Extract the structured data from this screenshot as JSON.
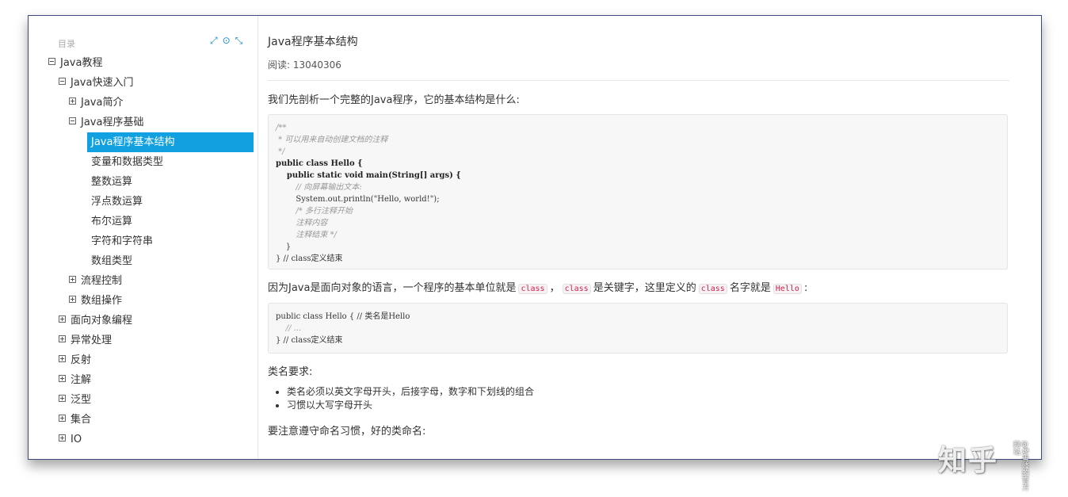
{
  "sidebar": {
    "toc_label": "目录",
    "tools": {
      "expand_icon": "⤢",
      "locate_icon": "⊙",
      "collapse_icon": "⤡"
    },
    "items": [
      {
        "label": "Java教程",
        "level": 0,
        "toggle": "minus"
      },
      {
        "label": "Java快速入门",
        "level": 1,
        "toggle": "minus"
      },
      {
        "label": "Java简介",
        "level": 2,
        "toggle": "plus"
      },
      {
        "label": "Java程序基础",
        "level": 2,
        "toggle": "minus"
      },
      {
        "label": "Java程序基本结构",
        "level": 3,
        "toggle": "none",
        "active": true
      },
      {
        "label": "变量和数据类型",
        "level": 3,
        "toggle": "none"
      },
      {
        "label": "整数运算",
        "level": 3,
        "toggle": "none"
      },
      {
        "label": "浮点数运算",
        "level": 3,
        "toggle": "none"
      },
      {
        "label": "布尔运算",
        "level": 3,
        "toggle": "none"
      },
      {
        "label": "字符和字符串",
        "level": 3,
        "toggle": "none"
      },
      {
        "label": "数组类型",
        "level": 3,
        "toggle": "none"
      },
      {
        "label": "流程控制",
        "level": 2,
        "toggle": "plus"
      },
      {
        "label": "数组操作",
        "level": 2,
        "toggle": "plus"
      },
      {
        "label": "面向对象编程",
        "level": 1,
        "toggle": "plus"
      },
      {
        "label": "异常处理",
        "level": 1,
        "toggle": "plus"
      },
      {
        "label": "反射",
        "level": 1,
        "toggle": "plus"
      },
      {
        "label": "注解",
        "level": 1,
        "toggle": "plus"
      },
      {
        "label": "泛型",
        "level": 1,
        "toggle": "plus"
      },
      {
        "label": "集合",
        "level": 1,
        "toggle": "plus"
      },
      {
        "label": "IO",
        "level": 1,
        "toggle": "plus"
      }
    ]
  },
  "main": {
    "title": "Java程序基本结构",
    "reads": "阅读: 13040306",
    "intro": "我们先剖析一个完整的Java程序，它的基本结构是什么:",
    "code1": [
      {
        "t": "/**",
        "cls": "c"
      },
      {
        "t": " * 可以用来自动创建文档的注释",
        "cls": "c"
      },
      {
        "t": " */",
        "cls": "c"
      },
      {
        "t": "public class Hello {",
        "cls": "k"
      },
      {
        "t": "    public static void main(String[] args) {",
        "cls": "km"
      },
      {
        "t": "        // 向屏幕输出文本:",
        "cls": "c"
      },
      {
        "t": "        System.out.println(\"Hello, world!\");",
        "cls": "s"
      },
      {
        "t": "        /* 多行注释开始",
        "cls": "c"
      },
      {
        "t": "        注释内容",
        "cls": "c"
      },
      {
        "t": "        注释结束 */",
        "cls": "c"
      },
      {
        "t": "    }",
        "cls": ""
      },
      {
        "t": "} // class定义结束",
        "cls": "mixed"
      }
    ],
    "para2": {
      "pre": "因为Java是面向对象的语言，一个程序的基本单位就是",
      "code_a": "class",
      "sep": "，",
      "code_b": "class",
      "mid": "是关键字，这里定义的",
      "code_c": "class",
      "mid2": "名字就是",
      "code_d": "Hello",
      "end": ":"
    },
    "code2": [
      {
        "t": "public class Hello { // 类名是Hello",
        "cls": "mixed2"
      },
      {
        "t": "    // ...",
        "cls": "c"
      },
      {
        "t": "} // class定义结束",
        "cls": "mixed"
      }
    ],
    "para3": "类名要求:",
    "bullets": [
      "类名必须以英文字母开头，后接字母，数字和下划线的组合",
      "习惯以大写字母开头"
    ],
    "para4": "要注意遵守命名习惯，好的类命名:"
  },
  "watermark": {
    "text": "知乎",
    "sub": "@廖雪峰的官方网站"
  }
}
